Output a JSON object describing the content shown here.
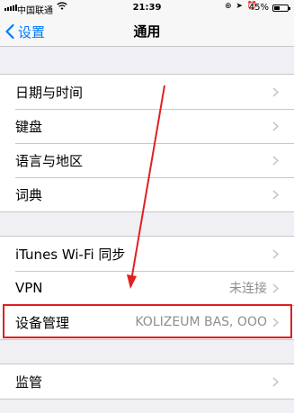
{
  "status_bar": {
    "carrier": "中国联通",
    "time": "21:39",
    "battery_percent": "45%",
    "battery_level": 0.45,
    "icons": [
      "signal-icon",
      "wifi-icon",
      "orientation-lock-icon",
      "location-icon",
      "alarm-icon",
      "battery-icon"
    ]
  },
  "nav": {
    "back_label": "设置",
    "title": "通用"
  },
  "groups": [
    {
      "rows": [
        {
          "label": "日期与时间"
        },
        {
          "label": "键盘"
        },
        {
          "label": "语言与地区"
        },
        {
          "label": "词典"
        }
      ]
    },
    {
      "rows": [
        {
          "label": "iTunes Wi-Fi 同步"
        },
        {
          "label": "VPN",
          "value": "未连接"
        },
        {
          "label": "设备管理",
          "value": "KOLIZEUM BAS, OOO"
        }
      ]
    },
    {
      "rows": [
        {
          "label": "监管"
        }
      ]
    }
  ],
  "colors": {
    "accent": "#007aff",
    "annotation": "#e02020",
    "background": "#efeff4"
  }
}
